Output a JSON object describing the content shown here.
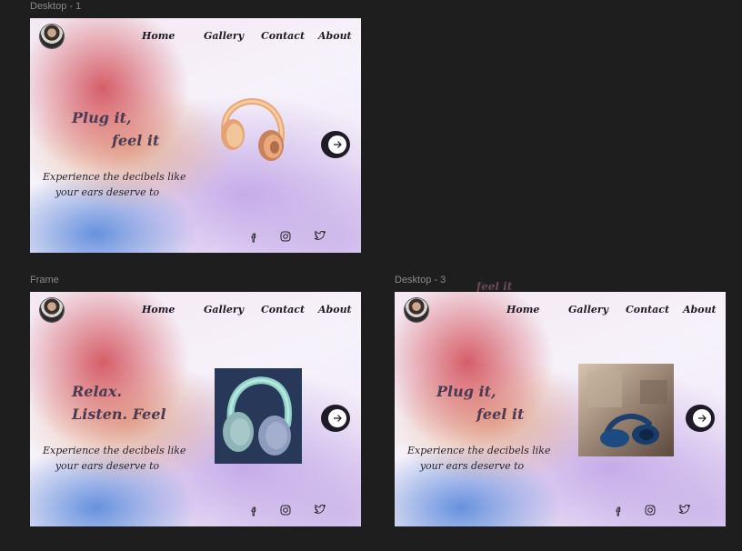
{
  "labels": {
    "frame1": "Desktop - 1",
    "frame2": "Frame",
    "frame3": "Desktop - 3"
  },
  "nav": {
    "home": "Home",
    "gallery": "Gallery",
    "contact": "Contact",
    "about": "About"
  },
  "frame1": {
    "line1": "Plug it,",
    "line2": "feel it",
    "tag1": "Experience the decibels like",
    "tag2": "your ears deserve to"
  },
  "frame2": {
    "line1": "Relax.",
    "line2": "Listen. Feel",
    "tag1": "Experience the decibels like",
    "tag2": "your ears deserve to"
  },
  "frame3": {
    "line1": "Plug it,",
    "line2": "feel it",
    "tag1": "Experience the decibels like",
    "tag2": "your ears deserve to",
    "peek": "feel it"
  },
  "icons": [
    "facebook-icon",
    "instagram-icon",
    "twitter-icon",
    "arrow-right-icon"
  ],
  "colors": {
    "canvas": "#1e1e1e",
    "text_dark": "#1d1a24",
    "headline": "#4b3a52",
    "button": "#1f1b26"
  }
}
